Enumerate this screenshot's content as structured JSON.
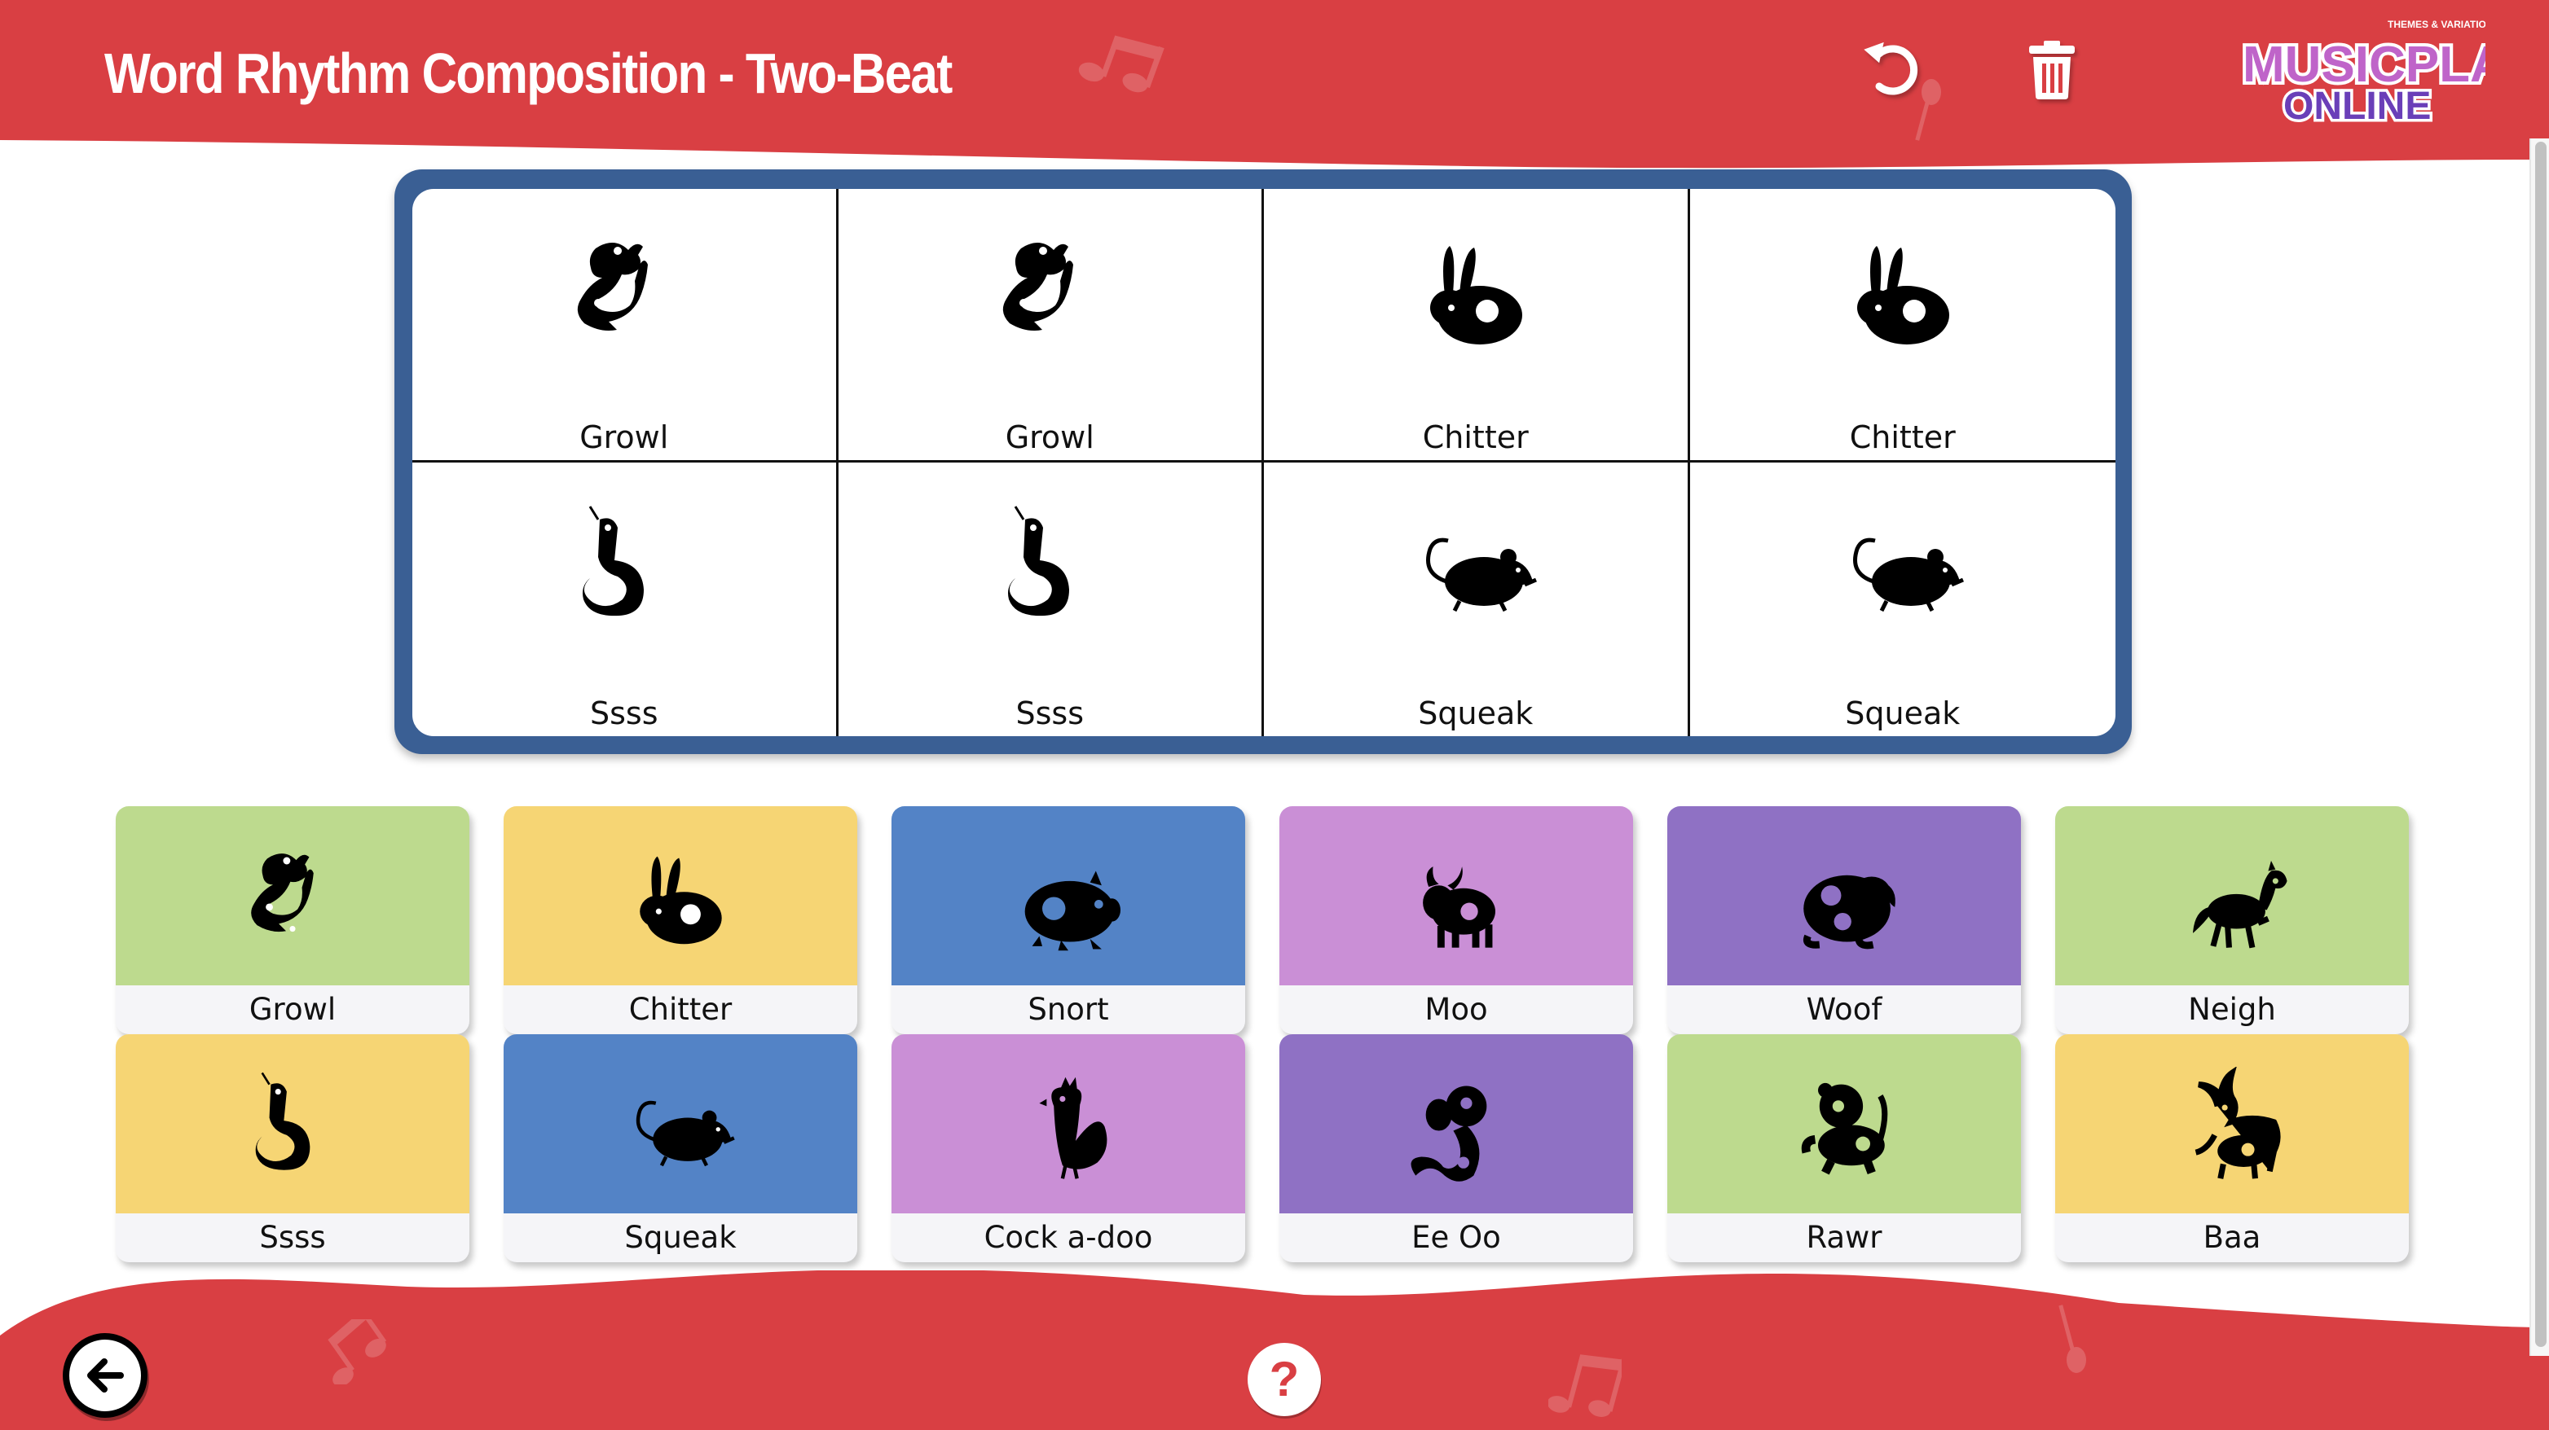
{
  "header": {
    "title": "Word Rhythm Composition - Two-Beat",
    "undo_icon": "undo-icon",
    "trash_icon": "trash-icon",
    "logo": {
      "tagline": "THEMES & VARIATIONS",
      "line1": "MUSICPLAY",
      "line2": "ONLINE"
    },
    "background_color": "#d93f43"
  },
  "composition": {
    "border_color": "#3a5f94",
    "slots": [
      {
        "animal": "dragon",
        "label": "Growl"
      },
      {
        "animal": "dragon",
        "label": "Growl"
      },
      {
        "animal": "rabbit",
        "label": "Chitter"
      },
      {
        "animal": "rabbit",
        "label": "Chitter"
      },
      {
        "animal": "snake",
        "label": "Ssss"
      },
      {
        "animal": "snake",
        "label": "Ssss"
      },
      {
        "animal": "rat",
        "label": "Squeak"
      },
      {
        "animal": "rat",
        "label": "Squeak"
      }
    ]
  },
  "palette": {
    "cards": [
      {
        "animal": "dragon",
        "label": "Growl",
        "color": "#bdda8e"
      },
      {
        "animal": "rabbit",
        "label": "Chitter",
        "color": "#f6d574"
      },
      {
        "animal": "pig",
        "label": "Snort",
        "color": "#5383c6"
      },
      {
        "animal": "ox",
        "label": "Moo",
        "color": "#ca8fd6"
      },
      {
        "animal": "dog",
        "label": "Woof",
        "color": "#8f71c4"
      },
      {
        "animal": "horse",
        "label": "Neigh",
        "color": "#bdda8e"
      },
      {
        "animal": "snake",
        "label": "Ssss",
        "color": "#f6d574"
      },
      {
        "animal": "rat",
        "label": "Squeak",
        "color": "#5383c6"
      },
      {
        "animal": "rooster",
        "label": "Cock a-doo",
        "color": "#ca8fd6"
      },
      {
        "animal": "monkey",
        "label": "Ee Oo",
        "color": "#8f71c4"
      },
      {
        "animal": "tiger",
        "label": "Rawr",
        "color": "#bdda8e"
      },
      {
        "animal": "goat",
        "label": "Baa",
        "color": "#f6d574"
      }
    ]
  },
  "footer": {
    "back_icon": "arrow-left-icon",
    "help_icon": "question-mark-icon",
    "help_symbol": "?"
  }
}
